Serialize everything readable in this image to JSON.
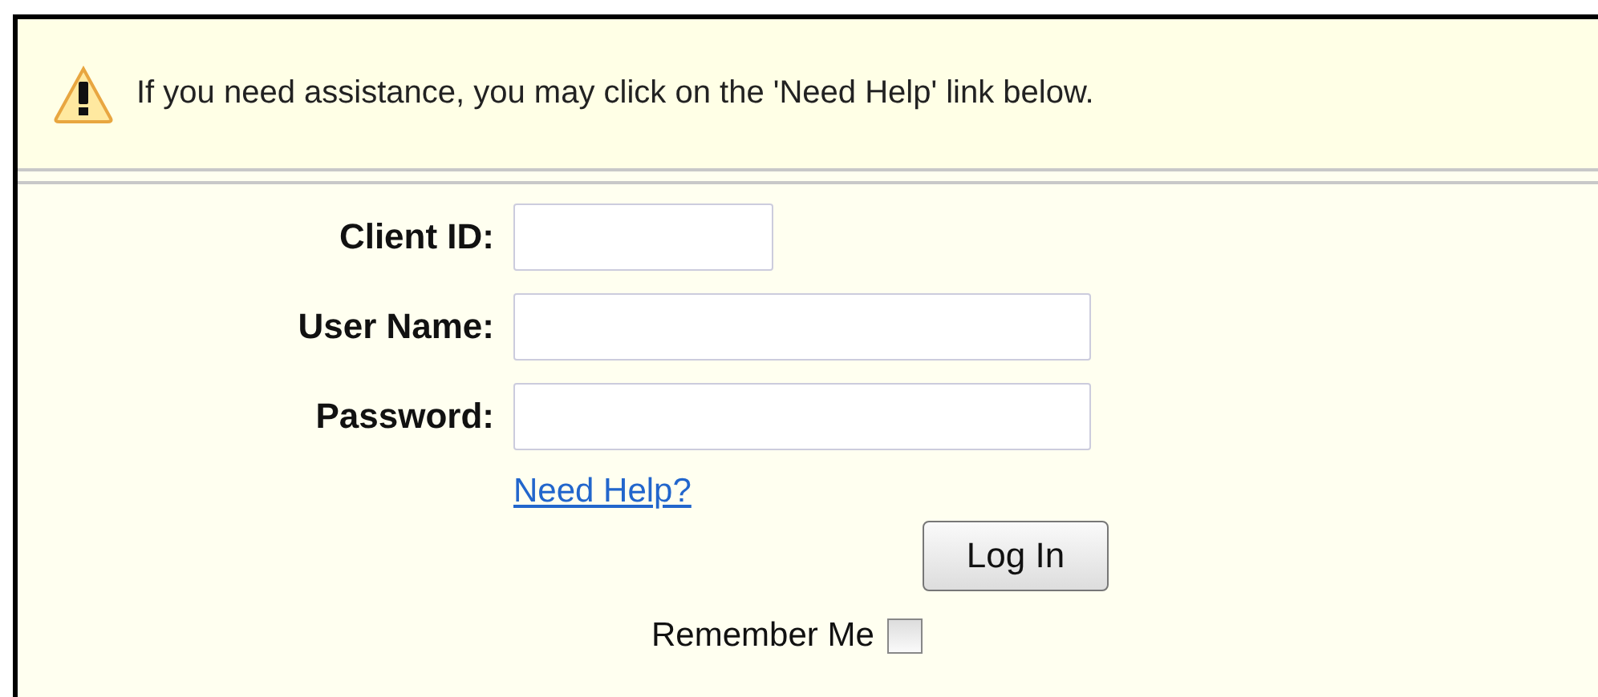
{
  "alert": {
    "message": "If you need assistance, you may click on the 'Need Help' link below."
  },
  "fields": [
    {
      "label": "Client ID:",
      "kind": "short"
    },
    {
      "label": "User Name:",
      "kind": "long"
    },
    {
      "label": "Password:",
      "kind": "long"
    }
  ],
  "help_link": "Need Help?",
  "login_button": "Log In",
  "remember_me": {
    "label": "Remember Me",
    "checked": false
  }
}
